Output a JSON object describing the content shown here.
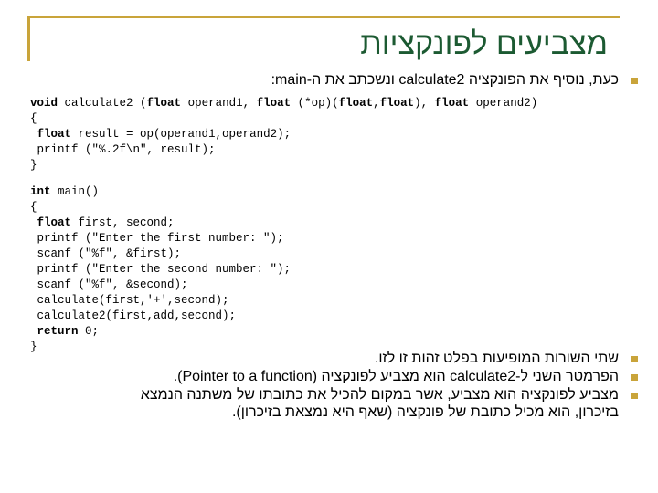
{
  "colors": {
    "accent": "#c9a43a",
    "title": "#1c5a32"
  },
  "title": "מצביעים לפונקציות",
  "intro_bullet": "כעת, נוסיף את הפונקציה calculate2 ונשכתב את ה-main:",
  "code_block_1": [
    {
      "kw": "void",
      "rest": " calculate2 (",
      "parts": [
        {
          "t": "void",
          "b": true
        },
        {
          "t": " calculate2 (",
          "b": false
        },
        {
          "t": "float",
          "b": true
        },
        {
          "t": " operand1, ",
          "b": false
        },
        {
          "t": "float",
          "b": true
        },
        {
          "t": " (*op)(",
          "b": false
        },
        {
          "t": "float",
          "b": true
        },
        {
          "t": ",",
          "b": false
        },
        {
          "t": "float",
          "b": true
        },
        {
          "t": "), ",
          "b": false
        },
        {
          "t": "float",
          "b": true
        },
        {
          "t": " operand2)",
          "b": false
        }
      ]
    },
    {
      "parts": [
        {
          "t": "{",
          "b": false
        }
      ]
    },
    {
      "parts": [
        {
          "t": " ",
          "b": false
        },
        {
          "t": "float",
          "b": true
        },
        {
          "t": " result = op(operand1,operand2);",
          "b": false
        }
      ]
    },
    {
      "parts": [
        {
          "t": " printf (\"%.2f\\n\", result);",
          "b": false
        }
      ]
    },
    {
      "parts": [
        {
          "t": "}",
          "b": false
        }
      ]
    }
  ],
  "code_block_2": [
    {
      "parts": [
        {
          "t": "int",
          "b": true
        },
        {
          "t": " main()",
          "b": false
        }
      ]
    },
    {
      "parts": [
        {
          "t": "{",
          "b": false
        }
      ]
    },
    {
      "parts": [
        {
          "t": " ",
          "b": false
        },
        {
          "t": "float",
          "b": true
        },
        {
          "t": " first, second;",
          "b": false
        }
      ]
    },
    {
      "parts": [
        {
          "t": " printf (\"Enter the first number: \");",
          "b": false
        }
      ]
    },
    {
      "parts": [
        {
          "t": " scanf (\"%f\", &first);",
          "b": false
        }
      ]
    },
    {
      "parts": [
        {
          "t": " printf (\"Enter the second number: \");",
          "b": false
        }
      ]
    },
    {
      "parts": [
        {
          "t": " scanf (\"%f\", &second);",
          "b": false
        }
      ]
    },
    {
      "parts": [
        {
          "t": " calculate(first,'+',second);",
          "b": false
        }
      ]
    },
    {
      "parts": [
        {
          "t": " calculate2(first,add,second);",
          "b": false
        }
      ]
    },
    {
      "parts": [
        {
          "t": " ",
          "b": false
        },
        {
          "t": "return",
          "b": true
        },
        {
          "t": " 0;",
          "b": false
        }
      ]
    },
    {
      "parts": [
        {
          "t": "}",
          "b": false
        }
      ]
    }
  ],
  "bullets": [
    {
      "lines": [
        "שתי השורות המופיעות בפלט זהות זו לזו."
      ]
    },
    {
      "lines": [
        "הפרמטר השני ל-calculate2 הוא מצביע לפונקציה (Pointer to a function)."
      ]
    },
    {
      "lines": [
        "מצביע לפונקציה הוא מצביע, אשר במקום להכיל את כתובתו של משתנה הנמצא",
        "בזיכרון, הוא מכיל כתובת של פונקציה (שאף היא נמצאת בזיכרון)."
      ]
    }
  ]
}
